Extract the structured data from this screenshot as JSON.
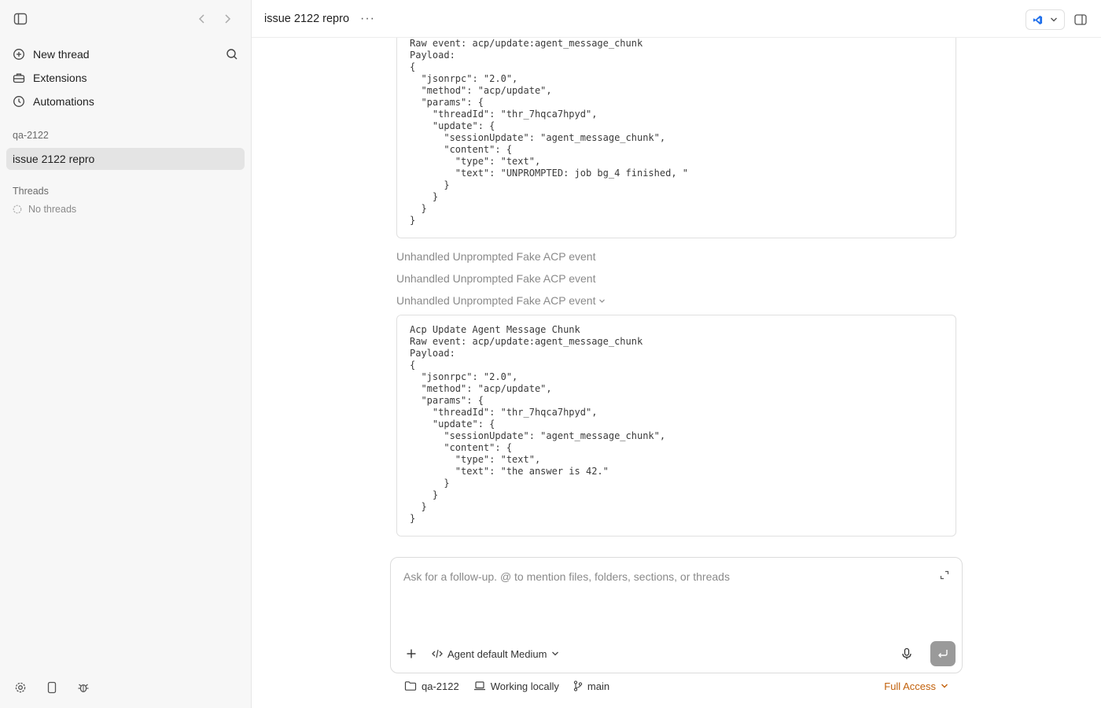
{
  "sidebar": {
    "menu": [
      {
        "label": "New thread",
        "icon": "plus-circle-icon"
      },
      {
        "label": "Extensions",
        "icon": "toolbox-icon"
      },
      {
        "label": "Automations",
        "icon": "clock-icon"
      }
    ],
    "project_label": "qa-2122",
    "active_thread": "issue 2122 repro",
    "threads_label": "Threads",
    "no_threads": "No threads"
  },
  "header": {
    "title": "issue 2122 repro",
    "more": "···"
  },
  "log": {
    "first_block": "Raw event: acp/update:agent_message_chunk\nPayload:\n{\n  \"jsonrpc\": \"2.0\",\n  \"method\": \"acp/update\",\n  \"params\": {\n    \"threadId\": \"thr_7hqca7hpyd\",\n    \"update\": {\n      \"sessionUpdate\": \"agent_message_chunk\",\n      \"content\": {\n        \"type\": \"text\",\n        \"text\": \"UNPROMPTED: job bg_4 finished, \"\n      }\n    }\n  }\n}",
    "events": [
      "Unhandled Unprompted Fake ACP event",
      "Unhandled Unprompted Fake ACP event",
      "Unhandled Unprompted Fake ACP event"
    ],
    "second_block": "Acp Update Agent Message Chunk\nRaw event: acp/update:agent_message_chunk\nPayload:\n{\n  \"jsonrpc\": \"2.0\",\n  \"method\": \"acp/update\",\n  \"params\": {\n    \"threadId\": \"thr_7hqca7hpyd\",\n    \"update\": {\n      \"sessionUpdate\": \"agent_message_chunk\",\n      \"content\": {\n        \"type\": \"text\",\n        \"text\": \"the answer is 42.\"\n      }\n    }\n  }\n}"
  },
  "composer": {
    "placeholder": "Ask for a follow-up. @ to mention files, folders, sections, or threads",
    "model": "Agent default Medium"
  },
  "status": {
    "folder": "qa-2122",
    "location": "Working locally",
    "branch": "main",
    "access": "Full Access"
  },
  "colors": {
    "accent_access": "#c2600a",
    "editor_icon": "#1f6feb"
  }
}
